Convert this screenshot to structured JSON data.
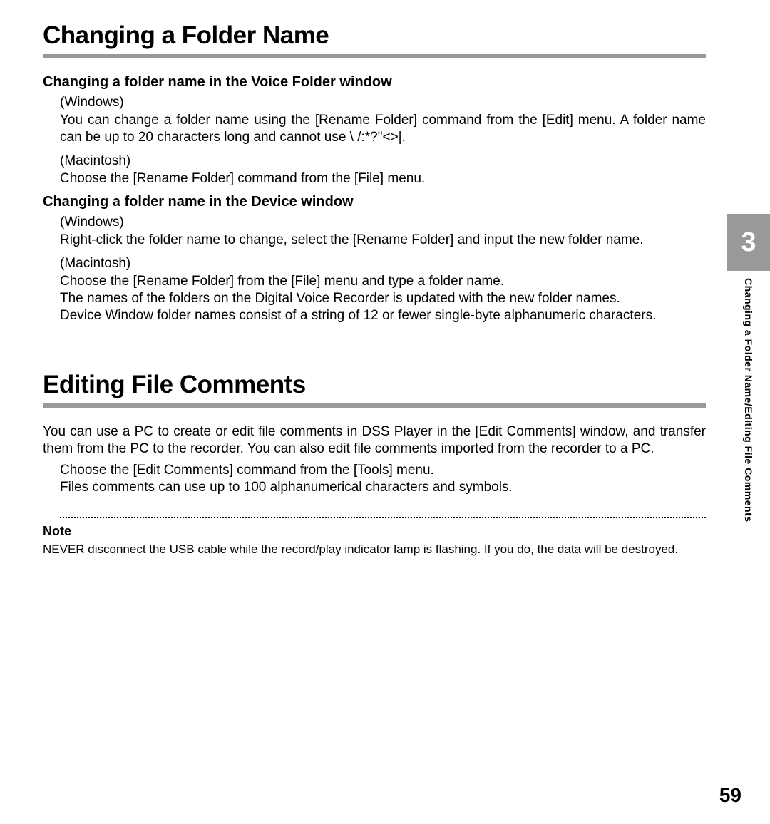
{
  "section1": {
    "title": "Changing a Folder Name",
    "sub1": {
      "heading": "Changing a folder name in the Voice Folder window",
      "win_label": "(Windows)",
      "win_text": "You can change a folder name using the [Rename Folder] command from the [Edit] menu. A folder name can be up to 20 characters long and cannot use \\ /:*?\"<>|.",
      "mac_label": "(Macintosh)",
      "mac_text": "Choose the [Rename Folder] command from the [File] menu."
    },
    "sub2": {
      "heading": "Changing a folder name in the Device window",
      "win_label": "(Windows)",
      "win_text": "Right-click the folder name to change, select the [Rename Folder] and input the new folder name.",
      "mac_label": "(Macintosh)",
      "mac_text1": "Choose the [Rename Folder] from the [File] menu and type a folder name.",
      "mac_text2": "The names of the folders on the Digital Voice Recorder is updated with the new folder names.",
      "mac_text3": "Device Window folder names consist of a string of 12 or fewer single-byte alphanumeric characters."
    }
  },
  "section2": {
    "title": "Editing File Comments",
    "intro": "You can use a PC to create or edit file comments in DSS Player in the [Edit Comments] window, and transfer them from the PC to the recorder. You can also edit file comments imported from the recorder to a PC.",
    "line1": "Choose the [Edit Comments] command from the [Tools] menu.",
    "line2": "Files comments can use up to 100 alphanumerical characters and symbols."
  },
  "note": {
    "heading": "Note",
    "text": "NEVER disconnect the USB cable while the record/play indicator lamp is flashing. If you do, the data will be destroyed."
  },
  "sidebar": {
    "chapter": "3",
    "label": "Changing a Folder Name/Editing File Comments"
  },
  "page_number": "59"
}
